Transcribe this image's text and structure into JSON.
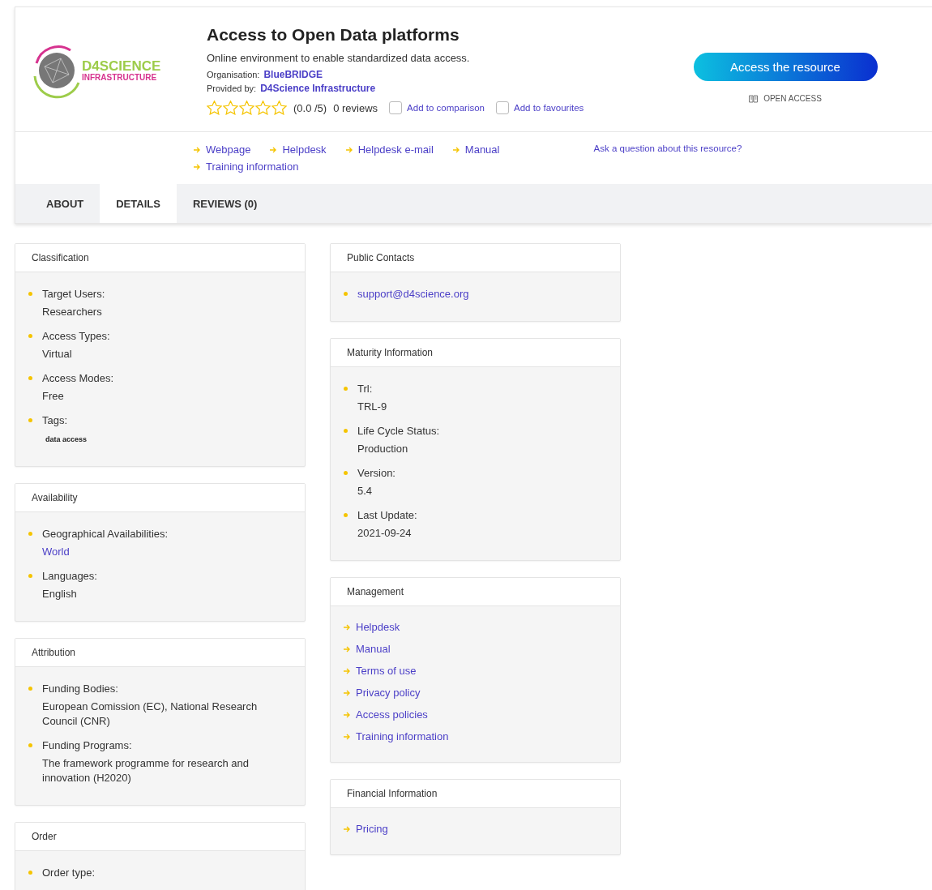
{
  "header": {
    "logo": {
      "line_1": "D4SCIENCE",
      "line_2": "INFRASTRUCTURE"
    },
    "title": "Access to Open Data platforms",
    "description": "Online environment to enable standardized data access.",
    "organisation": {
      "label": "Organisation:",
      "value": "BlueBRIDGE"
    },
    "provider": {
      "label": "Provided by:",
      "value": "D4Science Infrastructure"
    },
    "rating": {
      "stars": 0,
      "score": "(0.0 /5)",
      "reviews": "0 reviews"
    },
    "options": [
      {
        "label": "Add to comparison",
        "checked": false
      },
      {
        "label": "Add to favourites",
        "checked": false
      }
    ],
    "action_button": "Access the resource",
    "access_badge": "OPEN ACCESS",
    "links": [
      "Webpage",
      "Helpdesk",
      "Helpdesk e-mail",
      "Manual",
      "Training information"
    ],
    "question_link": "Ask a question about this resource?"
  },
  "tabs": [
    {
      "label": "ABOUT",
      "selected": false
    },
    {
      "label": "DETAILS",
      "selected": true
    },
    {
      "label": "REVIEWS (0)",
      "selected": false
    }
  ],
  "columns": [
    [
      {
        "title": "Classification",
        "items": [
          {
            "kind": "field",
            "label": "Target Users:",
            "value": "Researchers"
          },
          {
            "kind": "field",
            "label": "Access Types:",
            "value": "Virtual"
          },
          {
            "kind": "field",
            "label": "Access Modes:",
            "value": "Free"
          },
          {
            "kind": "tags",
            "label": "Tags:",
            "value": "data access"
          }
        ]
      },
      {
        "title": "Availability",
        "items": [
          {
            "kind": "link",
            "label": "Geographical Availabilities:",
            "value": "World"
          },
          {
            "kind": "field",
            "label": "Languages:",
            "value": "English"
          }
        ]
      },
      {
        "title": "Attribution",
        "items": [
          {
            "kind": "field",
            "label": "Funding Bodies:",
            "value": "European Comission (EC), National Research Council (CNR)"
          },
          {
            "kind": "field",
            "label": "Funding Programs:",
            "value": "The framework programme for research and innovation (H2020)"
          }
        ]
      },
      {
        "title": "Order",
        "items": [
          {
            "kind": "label",
            "label": "Order type:"
          }
        ]
      }
    ],
    [
      {
        "title": "Public Contacts",
        "items": [
          {
            "kind": "contact",
            "value": "support@d4science.org"
          }
        ]
      },
      {
        "title": "Maturity Information",
        "items": [
          {
            "kind": "field",
            "label": "Trl:",
            "value": "TRL-9"
          },
          {
            "kind": "field",
            "label": "Life Cycle Status:",
            "value": "Production"
          },
          {
            "kind": "field",
            "label": "Version:",
            "value": "5.4"
          },
          {
            "kind": "field",
            "label": "Last Update:",
            "value": "2021-09-24"
          }
        ]
      },
      {
        "title": "Management",
        "items": [
          {
            "kind": "arrow",
            "value": "Helpdesk"
          },
          {
            "kind": "arrow",
            "value": "Manual"
          },
          {
            "kind": "arrow",
            "value": "Terms of use"
          },
          {
            "kind": "arrow",
            "value": "Privacy policy"
          },
          {
            "kind": "arrow",
            "value": "Access policies"
          },
          {
            "kind": "arrow",
            "value": "Training information"
          }
        ]
      },
      {
        "title": "Financial Information",
        "items": [
          {
            "kind": "arrow",
            "value": "Pricing"
          }
        ]
      }
    ]
  ]
}
